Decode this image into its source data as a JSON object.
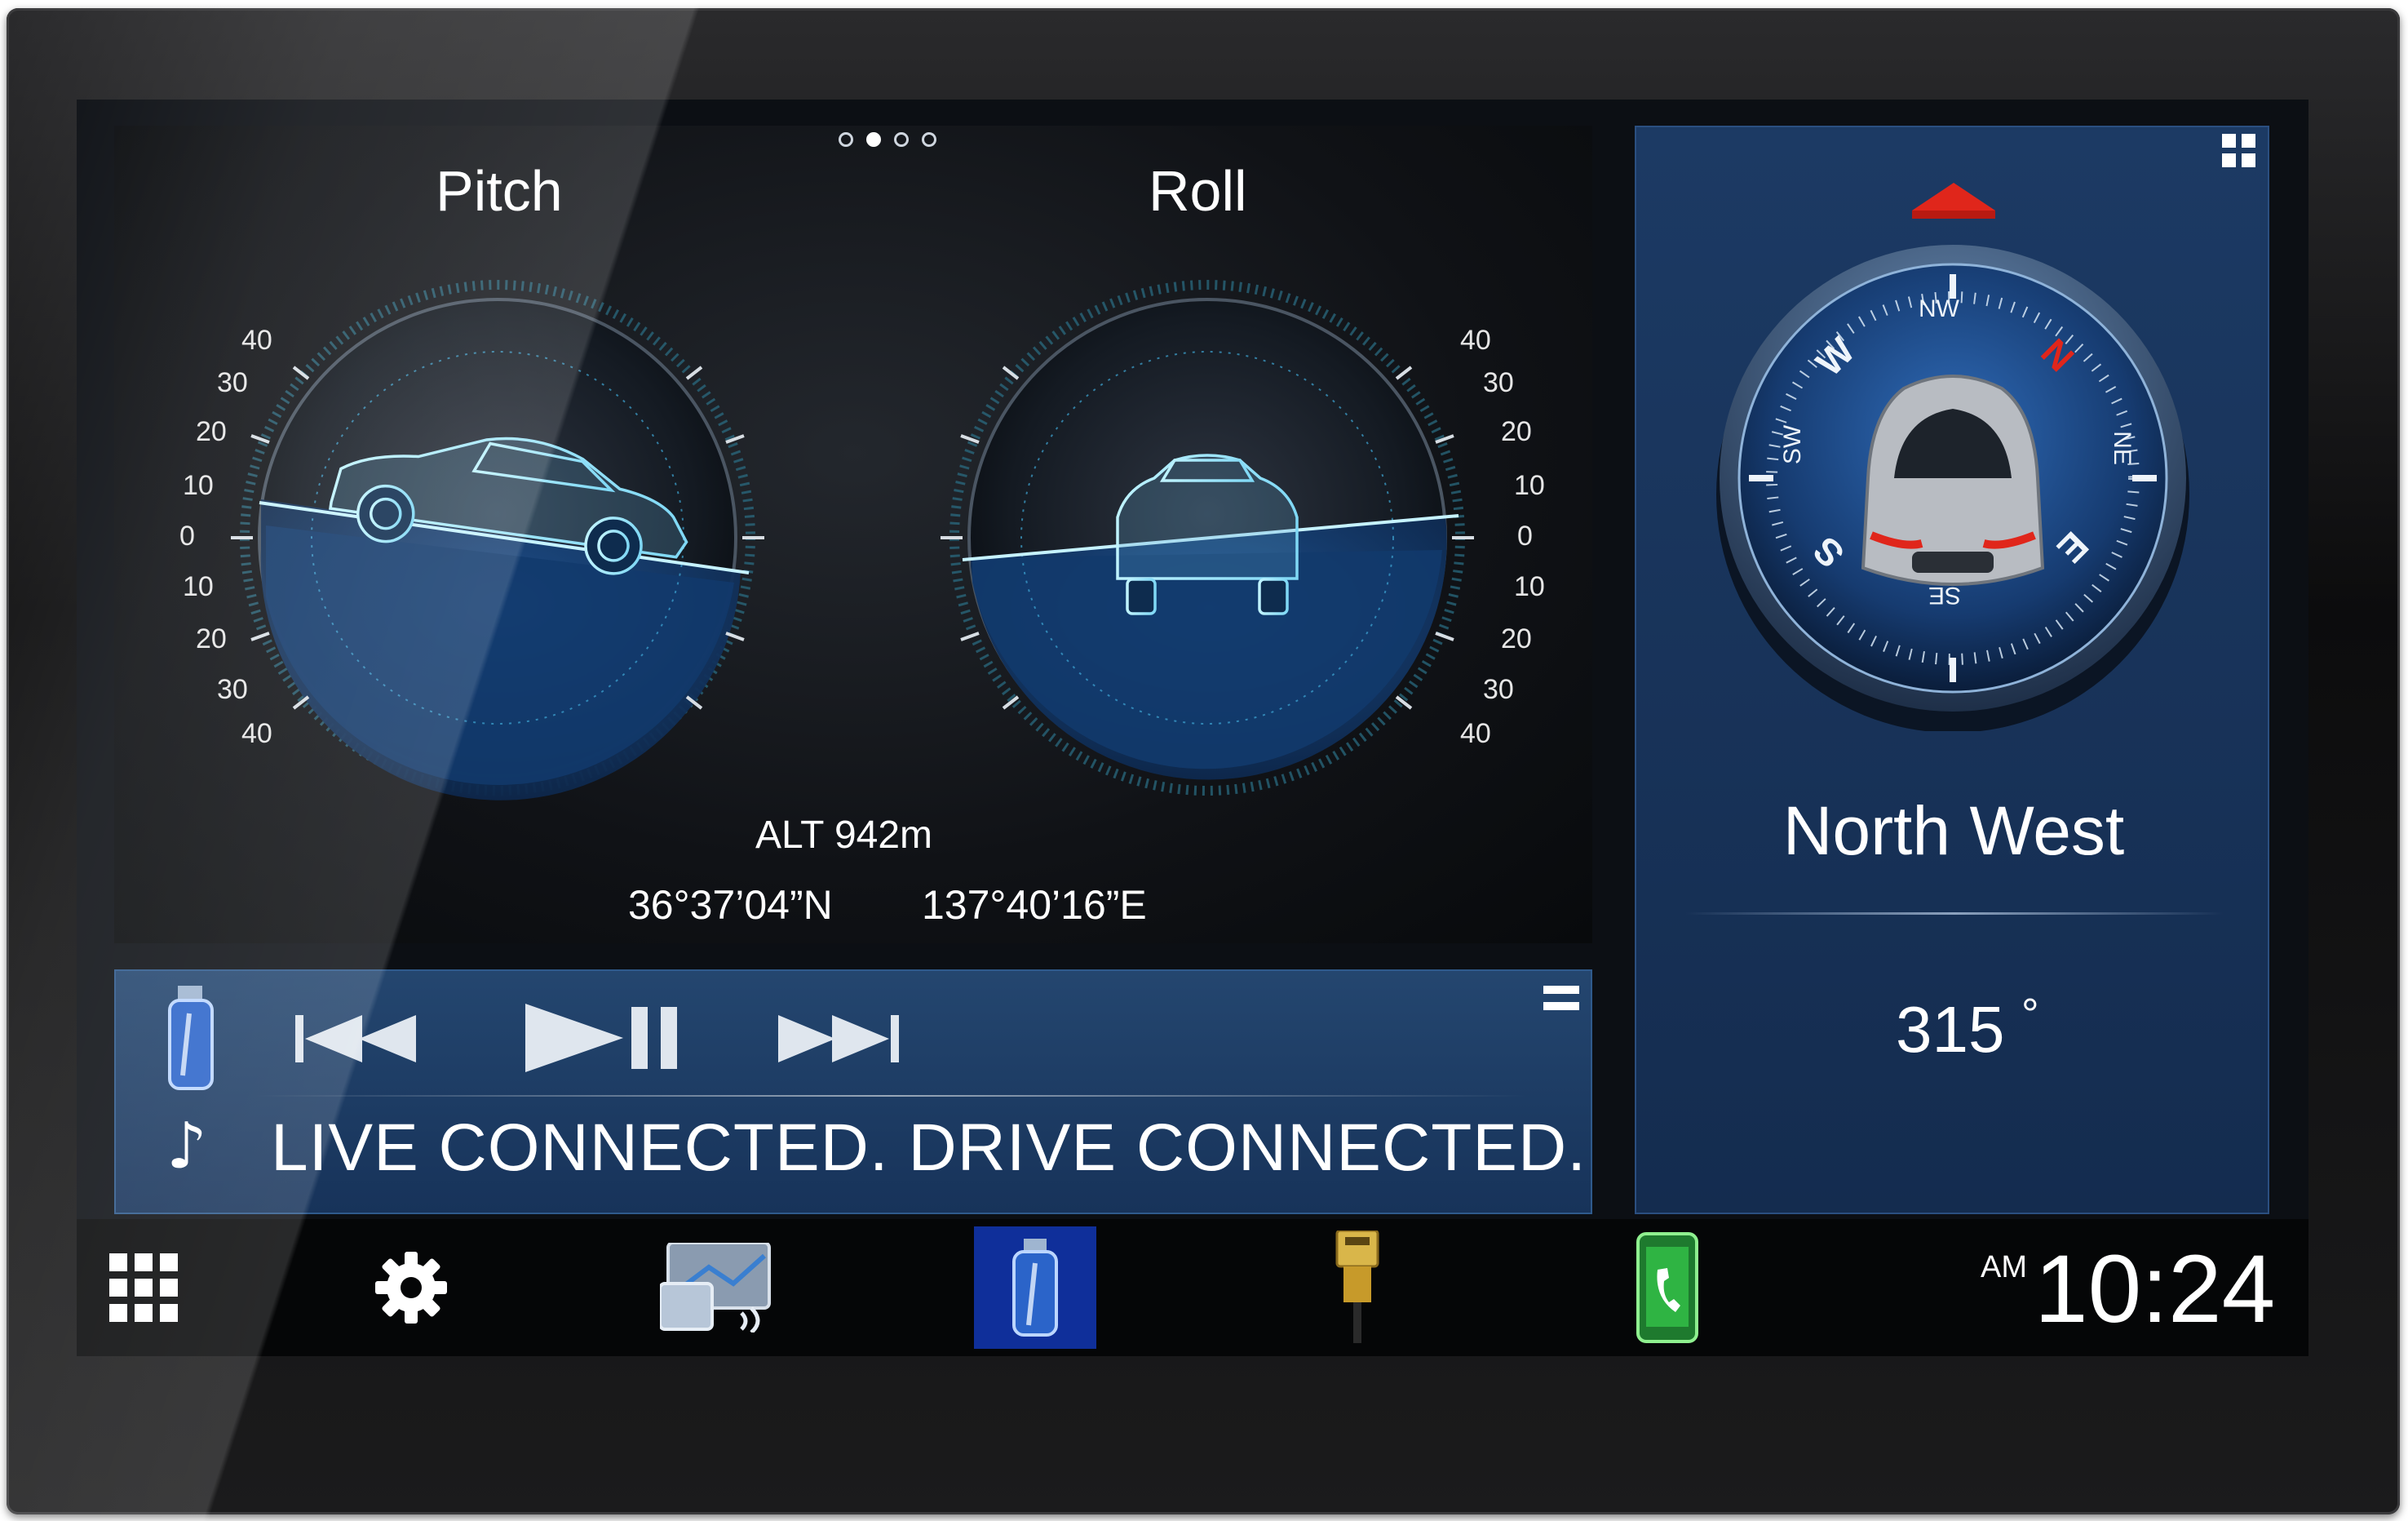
{
  "inclinometer": {
    "page_dots": [
      false,
      true,
      false,
      false
    ],
    "pitch": {
      "title": "Pitch",
      "labels_left": [
        "40",
        "30",
        "20",
        "10",
        "0",
        "10",
        "20",
        "30",
        "40"
      ]
    },
    "roll": {
      "title": "Roll",
      "labels_right": [
        "40",
        "30",
        "20",
        "10",
        "0",
        "10",
        "20",
        "30",
        "40"
      ]
    },
    "altitude": "ALT 942m",
    "latitude": "36°37’04”N",
    "longitude": "137°40’16”E"
  },
  "media": {
    "source_icon": "usb-drive-icon",
    "prev_icon": "skip-previous-icon",
    "play_pause_icon": "play-pause-icon",
    "next_icon": "skip-next-icon",
    "menu_icon": "list-menu-icon",
    "note_icon": "music-note-icon",
    "track_text": "LIVE CONNECTED. DRIVE CONNECTED."
  },
  "compass": {
    "widget_menu_icon": "grid-icon",
    "heading_marker_icon": "up-triangle-icon",
    "dial_labels": [
      "NW",
      "N",
      "NE",
      "E",
      "SE",
      "S",
      "SW",
      "W"
    ],
    "direction": "North West",
    "degrees": "315",
    "degree_symbol": "°"
  },
  "nav_bar": {
    "items": [
      {
        "name": "apps",
        "icon": "apps-grid-icon"
      },
      {
        "name": "settings",
        "icon": "gear-icon"
      },
      {
        "name": "navigation",
        "icon": "map-phone-icon"
      },
      {
        "name": "usb",
        "icon": "usb-drive-icon",
        "active": true
      },
      {
        "name": "hdmi",
        "icon": "hdmi-cable-icon"
      },
      {
        "name": "phone",
        "icon": "phone-icon"
      }
    ],
    "clock_ampm": "AM",
    "clock_time": "10:24"
  },
  "colors": {
    "accent_blue": "#2f6fd0",
    "marker_red": "#e0261b",
    "panel_blue": "#1c3a64"
  }
}
